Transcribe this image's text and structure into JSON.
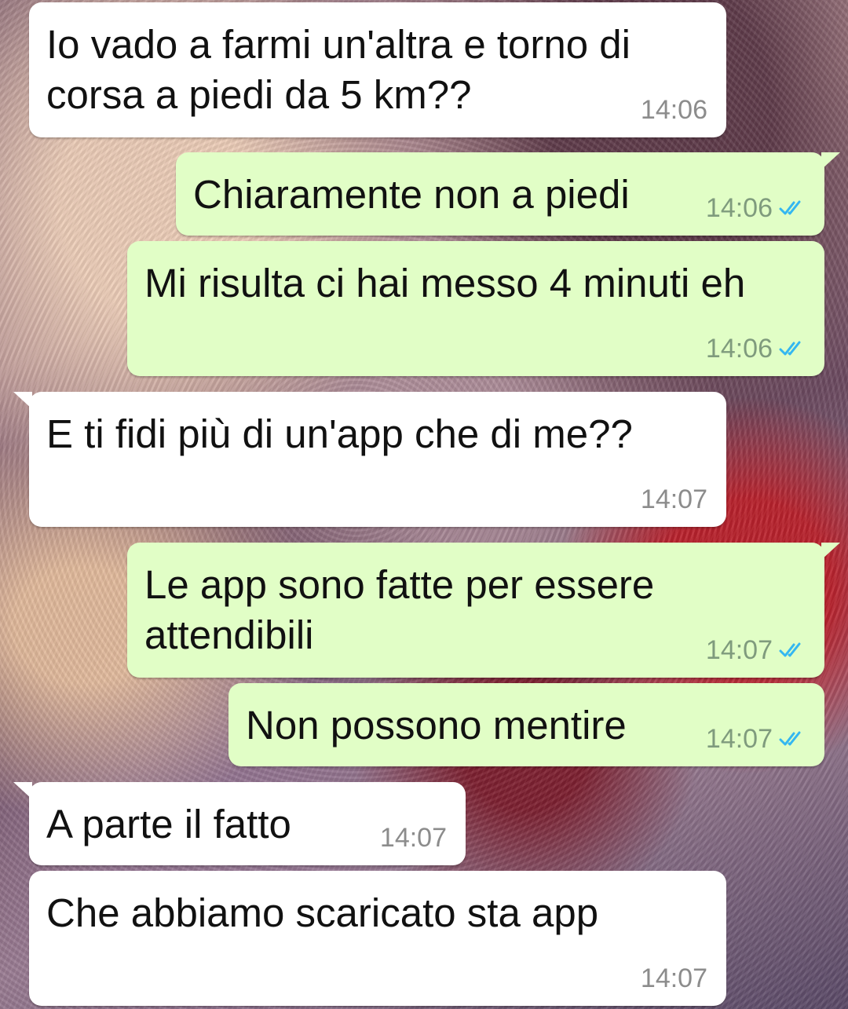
{
  "colors": {
    "incoming_bubble": "#ffffff",
    "outgoing_bubble": "#e1fec6",
    "read_receipt": "#34b7f1",
    "timestamp_incoming": "#8c8c8c",
    "timestamp_outgoing": "#7f9b7d"
  },
  "messages": [
    {
      "direction": "incoming",
      "text": "Io vado a farmi un'altra e torno di corsa a piedi da 5 km??",
      "time": "14:06",
      "status_icon": ""
    },
    {
      "direction": "outgoing",
      "text": "Chiaramente non a piedi",
      "time": "14:06",
      "status_icon": "double-check-read-icon"
    },
    {
      "direction": "outgoing",
      "text": "Mi risulta ci hai messo 4 minuti eh",
      "time": "14:06",
      "status_icon": "double-check-read-icon"
    },
    {
      "direction": "incoming",
      "text": "E ti fidi più di un'app che di me??",
      "time": "14:07",
      "status_icon": ""
    },
    {
      "direction": "outgoing",
      "text": "Le app sono fatte per essere attendibili",
      "time": "14:07",
      "status_icon": "double-check-read-icon"
    },
    {
      "direction": "outgoing",
      "text": "Non possono mentire",
      "time": "14:07",
      "status_icon": "double-check-read-icon"
    },
    {
      "direction": "incoming",
      "text": "A parte il fatto",
      "time": "14:07",
      "status_icon": ""
    },
    {
      "direction": "incoming",
      "text": "Che abbiamo scaricato sta app",
      "time": "14:07",
      "status_icon": ""
    }
  ]
}
